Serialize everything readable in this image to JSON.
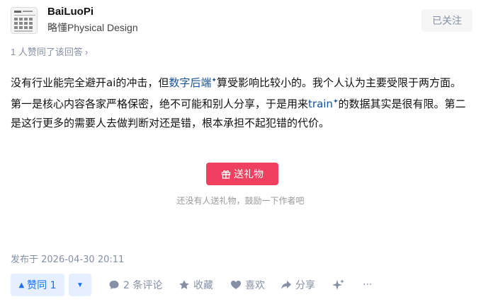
{
  "author": {
    "name": "BaiLuoPi",
    "headline": "略懂Physical Design",
    "follow_label": "已关注"
  },
  "vote_summary": "1 人赞同了该回答",
  "content": {
    "p1": "没有行业能完全避开ai的冲击，但",
    "kw1": "数字后端",
    "p2": "算受影响比较小的。我个人认为主要受限于两方面。第一是核心内容各家严格保密，绝不可能和别人分享，于是用来",
    "kw2": "train",
    "p3": "的数据其实是很有限。第二是这行更多的需要人去做判断对还是错，根本承担不起犯错的代价。"
  },
  "gift": {
    "button_label": "送礼物",
    "note": "还没有人送礼物，鼓励一下作者吧"
  },
  "published": "发布于 2026-04-30 20:11",
  "actions": {
    "upvote_label": "赞同 1",
    "comment_label": "2 条评论",
    "collect_label": "收藏",
    "like_label": "喜欢",
    "share_label": "分享",
    "more_label": "···"
  },
  "colors": {
    "accent": "#1772f6",
    "link": "#175199",
    "gift": "#f1405f",
    "muted": "#8590a6"
  }
}
